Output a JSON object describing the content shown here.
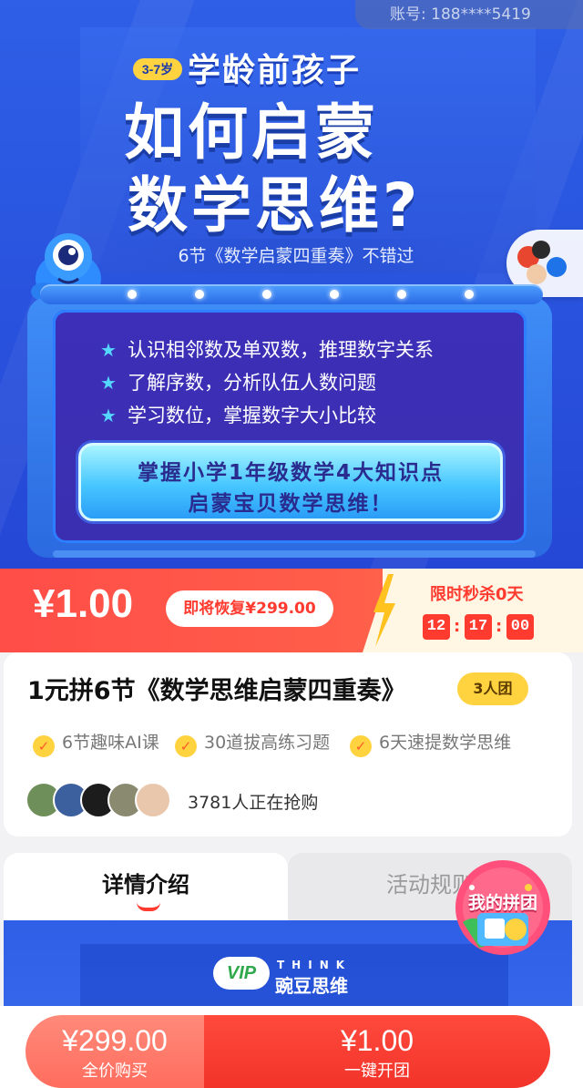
{
  "account": {
    "label": "账号:",
    "value": "188****5419"
  },
  "hero": {
    "age_tag": "3-7岁",
    "kicker": "学龄前孩子",
    "title_line1": "如何启蒙",
    "title_line2": "数学思维?",
    "subtitle": "6节《数学启蒙四重奏》不错过",
    "bullets": [
      "认识相邻数及单双数，推理数字关系",
      "了解序数，分析队伍人数问题",
      "学习数位，掌握数字大小比较"
    ],
    "cta_line1": "掌握小学1年级数学4大知识点",
    "cta_line2": "启蒙宝贝数学思维！"
  },
  "price": {
    "current": "¥1.00",
    "restore": "即将恢复¥299.00",
    "countdown_label": "限时秒杀0天",
    "countdown": {
      "hh": "12",
      "mm": "17",
      "ss": "00"
    }
  },
  "product": {
    "title": "1元拼6节《数学思维启蒙四重奏》",
    "team_badge": "3人团",
    "features": [
      "6节趣味AI课",
      "30道拔高练习题",
      "6天速提数学思维"
    ],
    "buyers": "3781人正在抢购"
  },
  "tabs": {
    "detail": "详情介绍",
    "rules": "活动规则"
  },
  "floating": {
    "my_group": "我的拼团"
  },
  "brand": {
    "logo": "VIP",
    "en": "THINK",
    "cn": "豌豆思维"
  },
  "bottom": {
    "full_price": "¥299.00",
    "full_label": "全价购买",
    "group_price": "¥1.00",
    "group_label": "一键开团"
  },
  "colors": {
    "accent": "#ff3b30",
    "brand_blue": "#2f5fe6",
    "badge_yellow": "#ffd23f"
  },
  "icons": [
    "star-icon",
    "check-icon",
    "mascot-icon",
    "share-icon",
    "lightning-icon",
    "my-group-icon"
  ]
}
